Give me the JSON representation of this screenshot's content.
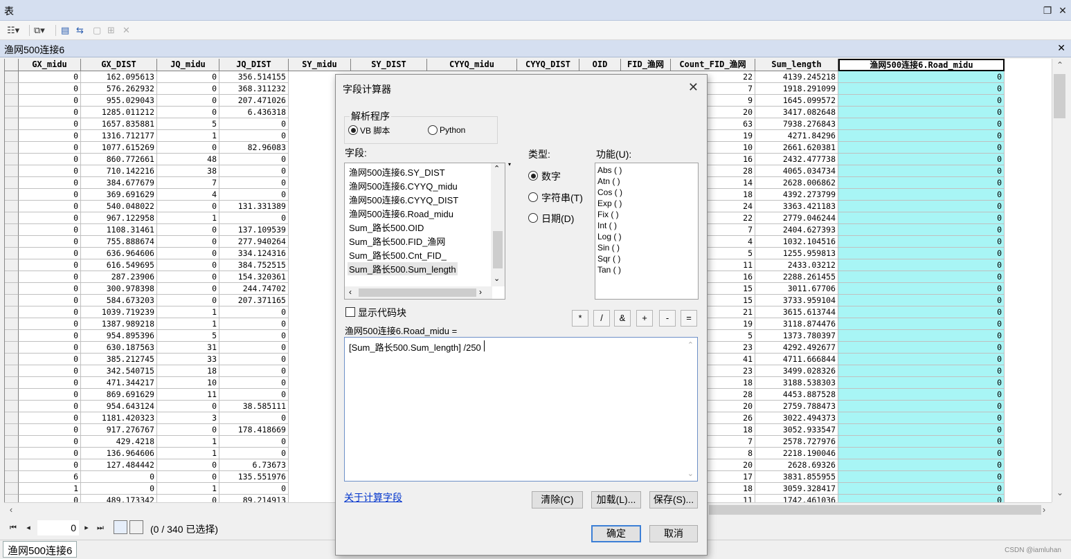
{
  "window": {
    "title": "表"
  },
  "toolbar": {
    "icons": [
      "table-options-icon",
      "related-tables-icon",
      "select-by-attributes-icon",
      "switch-selection-icon",
      "clear-selection-icon",
      "zoom-to-selected-icon",
      "delete-selected-icon"
    ]
  },
  "table_tab": {
    "title": "渔网500连接6"
  },
  "columns": [
    "GX_midu",
    "GX_DIST",
    "JQ_midu",
    "JQ_DIST",
    "SY_midu",
    "SY_DIST",
    "CYYQ_midu",
    "CYYQ_DIST",
    "OID",
    "FID_渔网",
    "Count_FID_渔网",
    "Sum_length",
    "渔网500连接6.Road_midu"
  ],
  "rows": [
    [
      "0",
      "162.095613",
      "0",
      "356.514155",
      "22",
      "4139.245218",
      "0"
    ],
    [
      "0",
      "576.262932",
      "0",
      "368.311232",
      "7",
      "1918.291099",
      "0"
    ],
    [
      "0",
      "955.029043",
      "0",
      "207.471026",
      "9",
      "1645.099572",
      "0"
    ],
    [
      "0",
      "1285.011212",
      "0",
      "6.436318",
      "20",
      "3417.082648",
      "0"
    ],
    [
      "0",
      "1657.835881",
      "5",
      "0",
      "63",
      "7938.276843",
      "0"
    ],
    [
      "0",
      "1316.712177",
      "1",
      "0",
      "19",
      "4271.84296",
      "0"
    ],
    [
      "0",
      "1077.615269",
      "0",
      "82.96083",
      "10",
      "2661.620381",
      "0"
    ],
    [
      "0",
      "860.772661",
      "48",
      "0",
      "16",
      "2432.477738",
      "0"
    ],
    [
      "0",
      "710.142216",
      "38",
      "0",
      "28",
      "4065.034734",
      "0"
    ],
    [
      "0",
      "384.677679",
      "7",
      "0",
      "14",
      "2628.006862",
      "0"
    ],
    [
      "0",
      "369.691629",
      "4",
      "0",
      "18",
      "4392.273799",
      "0"
    ],
    [
      "0",
      "540.048022",
      "0",
      "131.331389",
      "24",
      "3363.421183",
      "0"
    ],
    [
      "0",
      "967.122958",
      "1",
      "0",
      "22",
      "2779.046244",
      "0"
    ],
    [
      "0",
      "1108.31461",
      "0",
      "137.109539",
      "7",
      "2404.627393",
      "0"
    ],
    [
      "0",
      "755.888674",
      "0",
      "277.940264",
      "4",
      "1032.104516",
      "0"
    ],
    [
      "0",
      "636.964606",
      "0",
      "334.124316",
      "5",
      "1255.959813",
      "0"
    ],
    [
      "0",
      "616.549695",
      "0",
      "384.752515",
      "11",
      "2433.03212",
      "0"
    ],
    [
      "0",
      "287.23906",
      "0",
      "154.320361",
      "16",
      "2288.261455",
      "0"
    ],
    [
      "0",
      "300.978398",
      "0",
      "244.74702",
      "15",
      "3011.67706",
      "0"
    ],
    [
      "0",
      "584.673203",
      "0",
      "207.371165",
      "15",
      "3733.959104",
      "0"
    ],
    [
      "0",
      "1039.719239",
      "1",
      "0",
      "21",
      "3615.613744",
      "0"
    ],
    [
      "0",
      "1387.989218",
      "1",
      "0",
      "19",
      "3118.874476",
      "0"
    ],
    [
      "0",
      "954.895396",
      "5",
      "0",
      "5",
      "1373.780397",
      "0"
    ],
    [
      "0",
      "630.187563",
      "31",
      "0",
      "23",
      "4292.492677",
      "0"
    ],
    [
      "0",
      "385.212745",
      "33",
      "0",
      "41",
      "4711.666844",
      "0"
    ],
    [
      "0",
      "342.540715",
      "18",
      "0",
      "23",
      "3499.028326",
      "0"
    ],
    [
      "0",
      "471.344217",
      "10",
      "0",
      "18",
      "3188.538303",
      "0"
    ],
    [
      "0",
      "869.691629",
      "11",
      "0",
      "28",
      "4453.887528",
      "0"
    ],
    [
      "0",
      "954.643124",
      "0",
      "38.585111",
      "20",
      "2759.788473",
      "0"
    ],
    [
      "0",
      "1181.420323",
      "3",
      "0",
      "26",
      "3022.494373",
      "0"
    ],
    [
      "0",
      "917.276767",
      "0",
      "178.418669",
      "18",
      "3052.933547",
      "0"
    ],
    [
      "0",
      "429.4218",
      "1",
      "0",
      "7",
      "2578.727976",
      "0"
    ],
    [
      "0",
      "136.964606",
      "1",
      "0",
      "8",
      "2218.190046",
      "0"
    ],
    [
      "0",
      "127.484442",
      "0",
      "6.73673",
      "20",
      "2628.69326",
      "0"
    ],
    [
      "6",
      "0",
      "0",
      "135.551976",
      "17",
      "3831.855955",
      "0"
    ],
    [
      "1",
      "0",
      "1",
      "0",
      "18",
      "3059.328417",
      "0"
    ]
  ],
  "partial_row": [
    "0",
    "489.173342",
    "0",
    "89.214913",
    "11",
    "1742.461036",
    "0"
  ],
  "status": {
    "record_value": "0",
    "selection_info": "(0 / 340 已选择)"
  },
  "bottom_tab": {
    "label": "渔网500连接6"
  },
  "watermark": "CSDN @iamluhan",
  "dialog": {
    "title": "字段计算器",
    "parser_label": "解析程序",
    "parser_options": [
      "VB 脚本",
      "Python"
    ],
    "fields_label": "字段:",
    "fields": [
      "渔网500连接6.SY_DIST",
      "渔网500连接6.CYYQ_midu",
      "渔网500连接6.CYYQ_DIST",
      "渔网500连接6.Road_midu",
      "Sum_路长500.OID",
      "Sum_路长500.FID_渔网",
      "Sum_路长500.Cnt_FID_",
      "Sum_路长500.Sum_length"
    ],
    "type_label": "类型:",
    "type_options": [
      "数字",
      "字符串(T)",
      "日期(D)"
    ],
    "functions_label": "功能(U):",
    "functions": [
      "Abs ( )",
      "Atn ( )",
      "Cos ( )",
      "Exp ( )",
      "Fix ( )",
      "Int ( )",
      "Log ( )",
      "Sin ( )",
      "Sqr ( )",
      "Tan ( )"
    ],
    "show_codeblock": "显示代码块",
    "operators": [
      "*",
      "/",
      "&",
      "+",
      "-",
      "="
    ],
    "expression_label": "渔网500连接6.Road_midu =",
    "expression": "[Sum_路长500.Sum_length] /250",
    "help_link": "关于计算字段",
    "clear_btn": "清除(C)",
    "load_btn": "加载(L)...",
    "save_btn": "保存(S)...",
    "ok_btn": "确定",
    "cancel_btn": "取消"
  }
}
